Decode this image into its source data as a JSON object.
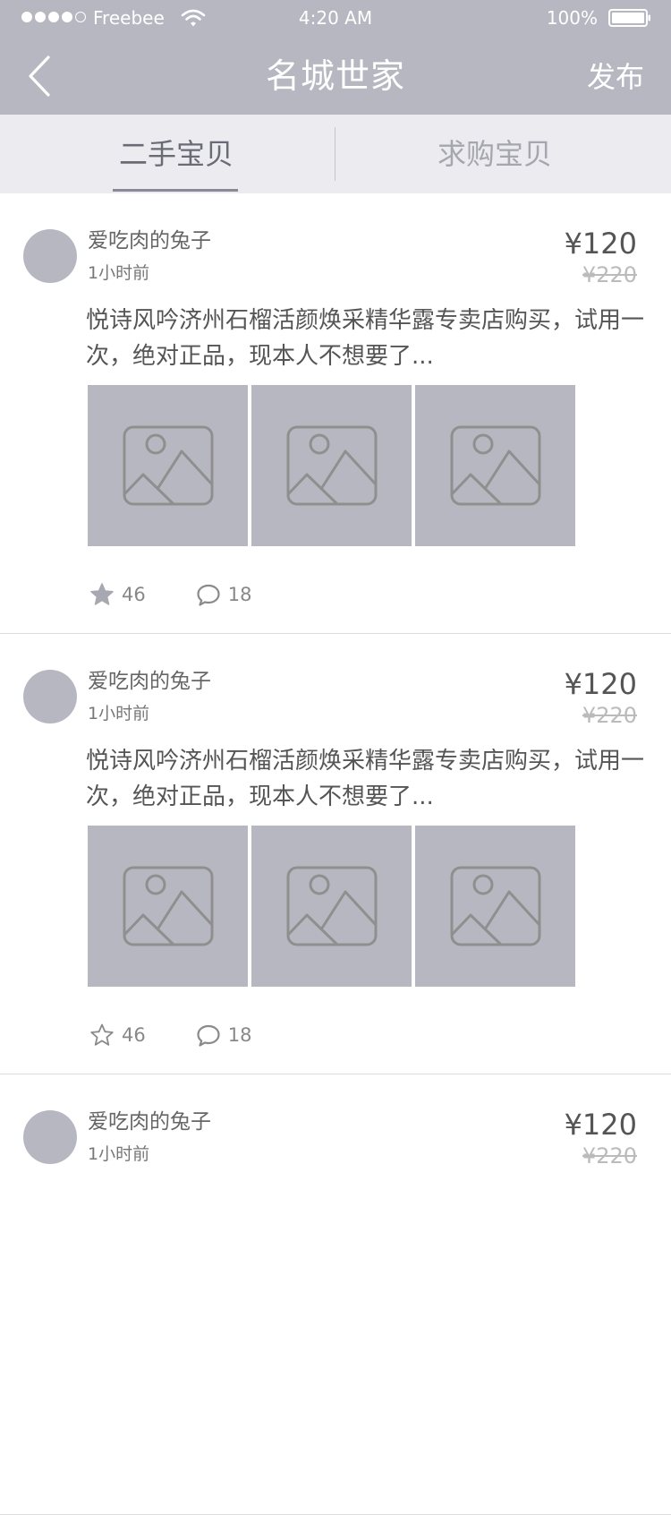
{
  "status_bar": {
    "carrier": "Freebee",
    "time": "4:20 AM",
    "battery": "100%"
  },
  "nav": {
    "title": "名城世家",
    "publish_label": "发布",
    "back_icon": "chevron-left-icon"
  },
  "tabs": [
    {
      "label": "二手宝贝",
      "active": true
    },
    {
      "label": "求购宝贝",
      "active": false
    }
  ],
  "colors": {
    "header_bg": "#b7b7c1",
    "tab_bg": "#ebebf0",
    "placeholder_bg": "#b7b7c1"
  },
  "posts": [
    {
      "user": "爱吃肉的兔子",
      "time": "1小时前",
      "price": "¥120",
      "original_price": "¥220",
      "description": "悦诗风吟济州石榴活颜焕采精华露专卖店购买，试用一次，绝对正品，现本人不想要了...",
      "images": [
        "image-placeholder-icon",
        "image-placeholder-icon",
        "image-placeholder-icon"
      ],
      "likes": "46",
      "liked": true,
      "comments": "18"
    },
    {
      "user": "爱吃肉的兔子",
      "time": "1小时前",
      "price": "¥120",
      "original_price": "¥220",
      "description": "悦诗风吟济州石榴活颜焕采精华露专卖店购买，试用一次，绝对正品，现本人不想要了...",
      "images": [
        "image-placeholder-icon",
        "image-placeholder-icon",
        "image-placeholder-icon"
      ],
      "likes": "46",
      "liked": false,
      "comments": "18"
    },
    {
      "user": "爱吃肉的兔子",
      "time": "1小时前",
      "price": "¥120",
      "original_price": "¥220"
    }
  ]
}
